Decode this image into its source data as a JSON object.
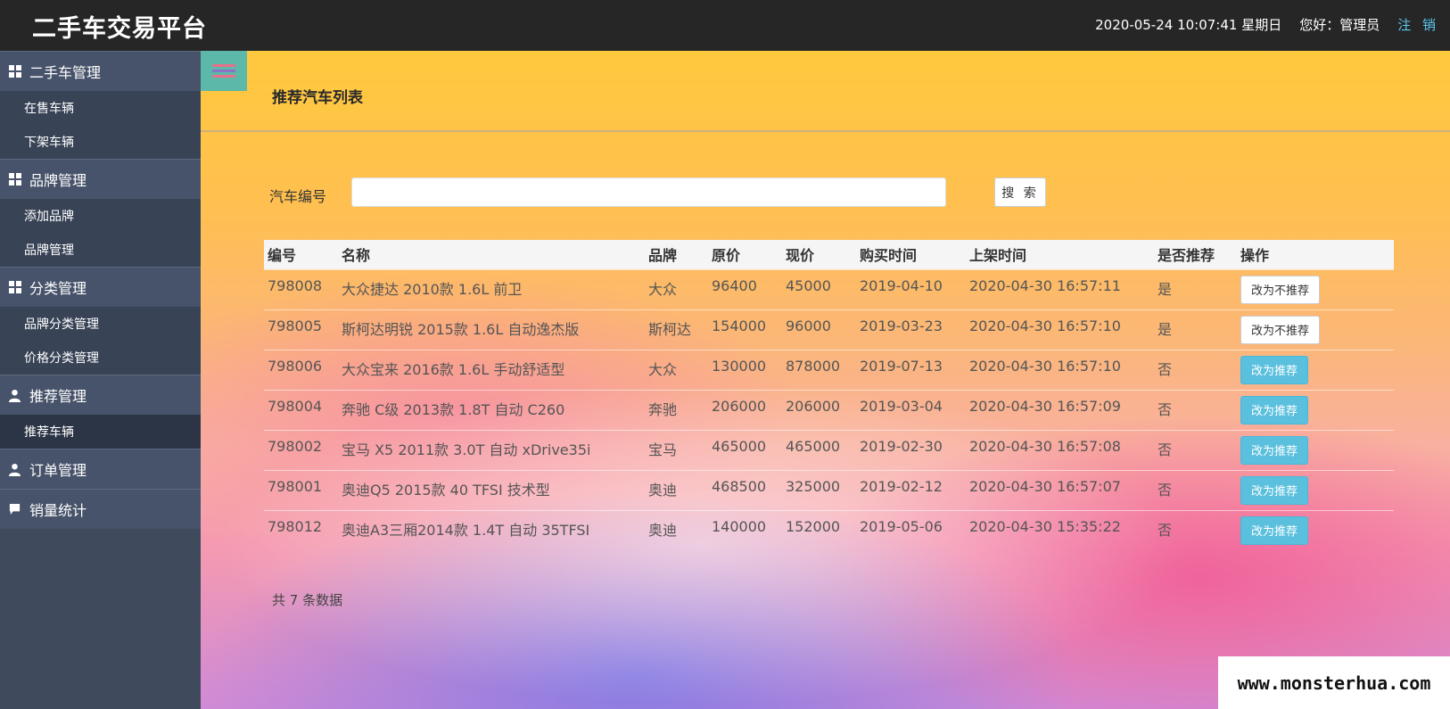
{
  "header": {
    "brand": "二手车交易平台",
    "datetime": "2020-05-24 10:07:41 星期日",
    "greeting": "您好：管理员",
    "logout": "注 销"
  },
  "sidebar": {
    "groups": [
      {
        "label": "二手车管理",
        "icon": "grid-icon",
        "items": [
          "在售车辆",
          "下架车辆"
        ]
      },
      {
        "label": "品牌管理",
        "icon": "grid-icon",
        "items": [
          "添加品牌",
          "品牌管理"
        ]
      },
      {
        "label": "分类管理",
        "icon": "grid-icon",
        "items": [
          "品牌分类管理",
          "价格分类管理"
        ]
      },
      {
        "label": "推荐管理",
        "icon": "user-icon",
        "items": [
          "推荐车辆"
        ],
        "active_item": "推荐车辆"
      },
      {
        "label": "订单管理",
        "icon": "user-icon",
        "items": []
      },
      {
        "label": "销量统计",
        "icon": "comment-icon",
        "items": []
      }
    ]
  },
  "main": {
    "title": "推荐汽车列表",
    "search": {
      "label": "汽车编号",
      "value": "",
      "button": "搜 索"
    },
    "table": {
      "headers": [
        "编号",
        "名称",
        "品牌",
        "原价",
        "现价",
        "购买时间",
        "上架时间",
        "是否推荐",
        "操作"
      ],
      "rows": [
        {
          "id": "798008",
          "name": "大众捷达 2010款 1.6L 前卫",
          "brand": "大众",
          "orig": "96400",
          "price": "45000",
          "buy": "2019-04-10",
          "listed": "2020-04-30 16:57:11",
          "rec": "是",
          "action": "改为不推荐"
        },
        {
          "id": "798005",
          "name": "斯柯达明锐 2015款 1.6L 自动逸杰版",
          "brand": "斯柯达",
          "orig": "154000",
          "price": "96000",
          "buy": "2019-03-23",
          "listed": "2020-04-30 16:57:10",
          "rec": "是",
          "action": "改为不推荐"
        },
        {
          "id": "798006",
          "name": "大众宝来 2016款 1.6L 手动舒适型",
          "brand": "大众",
          "orig": "130000",
          "price": "878000",
          "buy": "2019-07-13",
          "listed": "2020-04-30 16:57:10",
          "rec": "否",
          "action": "改为推荐"
        },
        {
          "id": "798004",
          "name": "奔驰 C级 2013款 1.8T 自动 C260",
          "brand": "奔驰",
          "orig": "206000",
          "price": "206000",
          "buy": "2019-03-04",
          "listed": "2020-04-30 16:57:09",
          "rec": "否",
          "action": "改为推荐"
        },
        {
          "id": "798002",
          "name": "宝马 X5 2011款 3.0T 自动 xDrive35i",
          "brand": "宝马",
          "orig": "465000",
          "price": "465000",
          "buy": "2019-02-30",
          "listed": "2020-04-30 16:57:08",
          "rec": "否",
          "action": "改为推荐"
        },
        {
          "id": "798001",
          "name": "奥迪Q5 2015款 40 TFSI 技术型",
          "brand": "奥迪",
          "orig": "468500",
          "price": "325000",
          "buy": "2019-02-12",
          "listed": "2020-04-30 16:57:07",
          "rec": "否",
          "action": "改为推荐"
        },
        {
          "id": "798012",
          "name": "奥迪A3三厢2014款 1.4T 自动 35TFSI",
          "brand": "奥迪",
          "orig": "140000",
          "price": "152000",
          "buy": "2019-05-06",
          "listed": "2020-04-30 15:35:22",
          "rec": "否",
          "action": "改为推荐"
        }
      ]
    },
    "total": "共 7 条数据"
  },
  "watermark": "www.monsterhua.com",
  "colors": {
    "topbar": "#262626",
    "sidebar": "#3f4a5d",
    "accent_blue": "#5bc0de",
    "logout": "#5bc8f0",
    "toggle": "#5cb8a8"
  }
}
